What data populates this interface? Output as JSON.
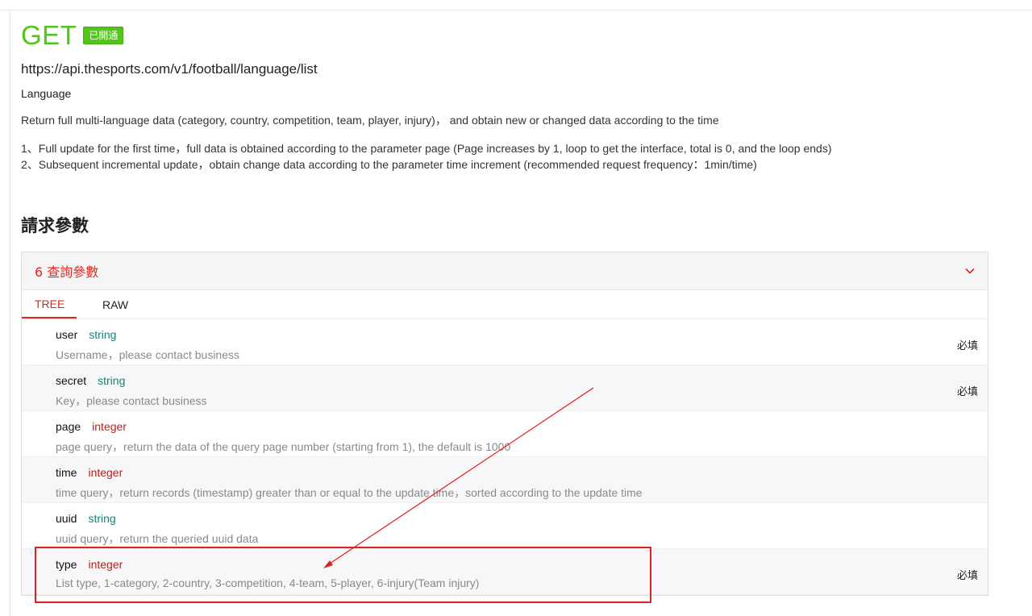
{
  "header": {
    "method": "GET",
    "badge": "已開通",
    "url": "https://api.thesports.com/v1/football/language/list",
    "title": "Language",
    "description": "Return full multi-language data (category, country, competition, team, player, injury)， and obtain new or changed data according to the time",
    "steps": [
      "1、Full update for the first time，full data is obtained according to the parameter page (Page increases by 1, loop to get the interface, total is 0, and the loop ends)",
      "2、Subsequent incremental update，obtain change data according to the parameter time increment (recommended request frequency：1min/time)"
    ]
  },
  "section_title": "請求參數",
  "params_panel": {
    "title": "6 查詢參數",
    "tabs": [
      "TREE",
      "RAW"
    ],
    "active_tab": "TREE",
    "params": [
      {
        "name": "user",
        "type": "string",
        "description": "Username，please contact business",
        "required": "必填"
      },
      {
        "name": "secret",
        "type": "string",
        "description": "Key，please contact business",
        "required": "必填"
      },
      {
        "name": "page",
        "type": "integer",
        "description": "page query，return the data of the query page number (starting from 1), the default is 1000",
        "required": ""
      },
      {
        "name": "time",
        "type": "integer",
        "description": "time query，return records (timestamp) greater than or equal to the update time，sorted according to the update time",
        "required": ""
      },
      {
        "name": "uuid",
        "type": "string",
        "description": "uuid query，return the queried uuid data",
        "required": ""
      },
      {
        "name": "type",
        "type": "integer",
        "description": "List type, 1-category, 2-country, 3-competition, 4-team, 5-player, 6-injury(Team injury)",
        "required": "必填"
      }
    ]
  },
  "colors": {
    "method": "#52c41a",
    "accent": "#e0271e",
    "string_type": "#12857a",
    "integer_type": "#b1231a",
    "annotation": "#e02020"
  },
  "icons": {
    "collapse": "chevron-down-icon"
  }
}
